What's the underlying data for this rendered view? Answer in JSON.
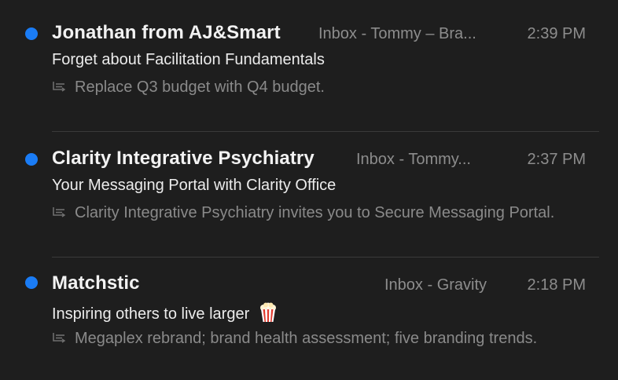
{
  "messages": [
    {
      "sender": "Jonathan from AJ&Smart",
      "mailbox": "Inbox - Tommy – Bra...",
      "time": "2:39 PM",
      "subject": "Forget about Facilitation Fundamentals",
      "preview": "Replace Q3 budget with Q4 budget.",
      "unread": true
    },
    {
      "sender": "Clarity Integrative Psychiatry",
      "mailbox": "Inbox - Tommy...",
      "time": "2:37 PM",
      "subject": "Your Messaging Portal with Clarity Office",
      "preview": "Clarity Integrative Psychiatry invites you to Secure Messaging Portal.",
      "unread": true
    },
    {
      "sender": "Matchstic",
      "mailbox": "Inbox - Gravity",
      "time": "2:18 PM",
      "subject": "Inspiring others to live larger",
      "subject_emoji": "popcorn-icon",
      "preview": "Megaplex rebrand; brand health assessment; five branding trends.",
      "unread": true
    }
  ],
  "colors": {
    "background": "#1e1e1e",
    "unread_dot": "#1a7cf5",
    "sender": "#f2f2f2",
    "secondary": "#8d8d8d",
    "separator": "#3a3a3a"
  }
}
